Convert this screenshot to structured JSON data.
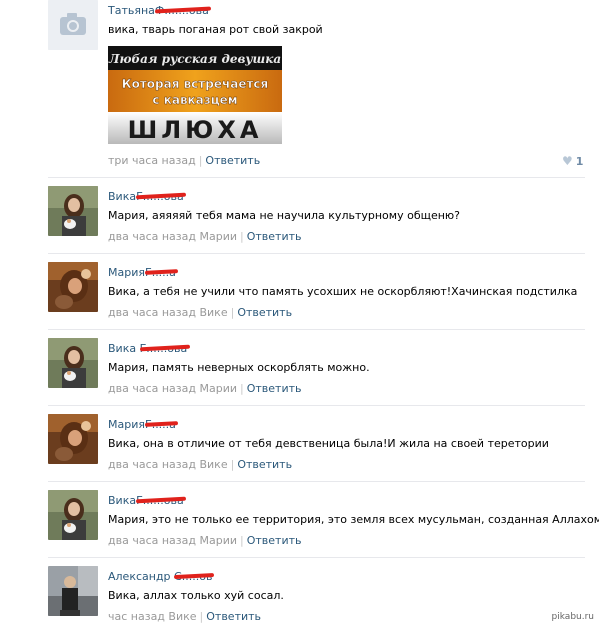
{
  "comments": [
    {
      "author_first": "Татьяна",
      "author_last": "Ф.......ова",
      "text": "вика, тварь поганая рот свой закрой",
      "time": "три часа назад",
      "reply_to": "",
      "reply_label": "Ответить",
      "likes": "1",
      "attachment_lines": [
        "Любая русская девушка",
        "Которая встречается",
        "с кавказцем",
        "ШЛЮХА"
      ]
    },
    {
      "author_first": "Вика",
      "author_last": "Г......ова",
      "text": "Мария, аяяяяй тебя мама не научила культурному общеню?",
      "time": "два часа назад",
      "reply_to": "Марии",
      "reply_label": "Ответить"
    },
    {
      "author_first": "Мария",
      "author_last": "Г.....а",
      "text": "Вика, а тебя не учили что память усохших не оскорбляют!Хачинская подстилка",
      "time": "два часа назад",
      "reply_to": "Вике",
      "reply_label": "Ответить"
    },
    {
      "author_first": "Вика",
      "author_last": "Г......ова",
      "text": "Мария, память неверных оскорблять можно.",
      "time": "два часа назад",
      "reply_to": "Марии",
      "reply_label": "Ответить"
    },
    {
      "author_first": "Мария",
      "author_last": "Г.....а",
      "text": "Вика, она в отличие от тебя девственица была!И жила на своей теретории",
      "time": "два часа назад",
      "reply_to": "Вике",
      "reply_label": "Ответить"
    },
    {
      "author_first": "Вика",
      "author_last": "Г......ова",
      "text": "Мария, это не только ее территория, это земля всех мусульман, созданная Аллахом.",
      "time": "два часа назад",
      "reply_to": "Марии",
      "reply_label": "Ответить"
    },
    {
      "author_first": "Александр",
      "author_last": "С.....ов",
      "text": "Вика, аллах только хуй сосал.",
      "time": "час назад",
      "reply_to": "Вике",
      "reply_label": "Ответить"
    }
  ],
  "watermark": "pikabu.ru",
  "colors": {
    "link": "#2b587a",
    "meta": "#999999",
    "divider": "#e7e8ec",
    "redaction": "#e0221c"
  }
}
